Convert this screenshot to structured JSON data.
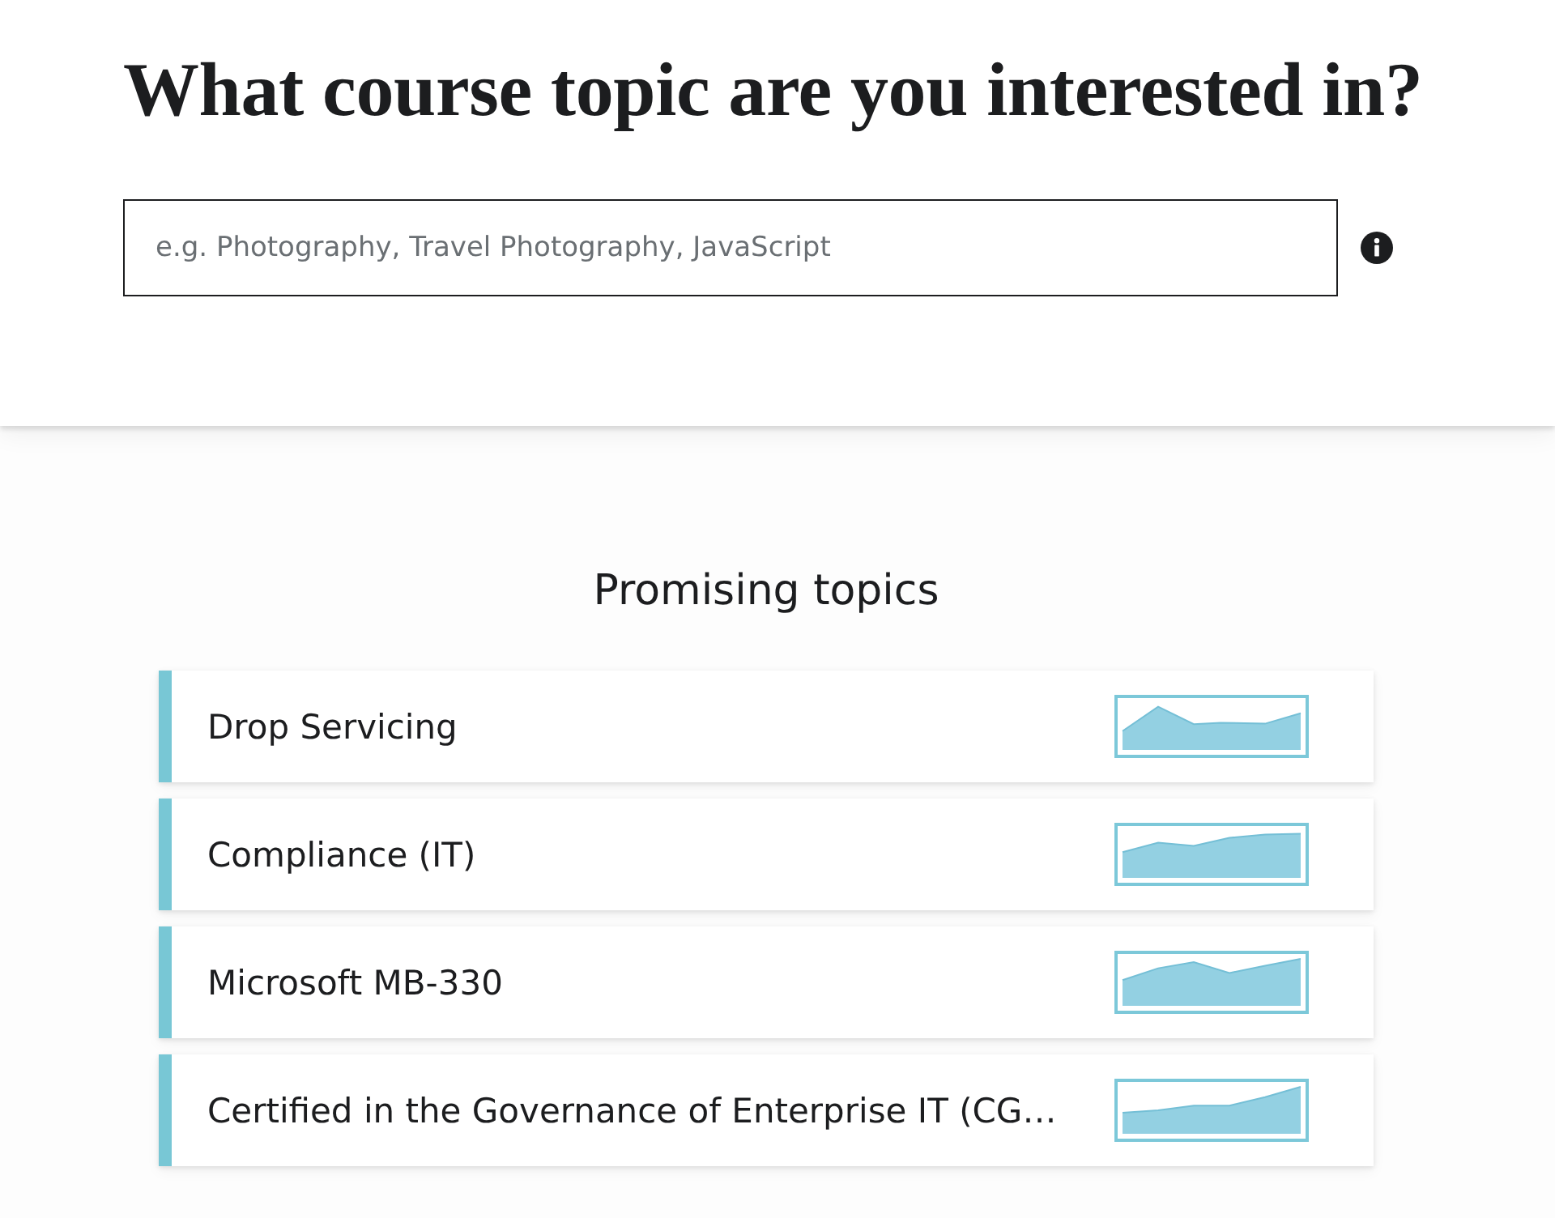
{
  "heading": "What course topic are you interested in?",
  "search": {
    "placeholder": "e.g. Photography, Travel Photography, JavaScript"
  },
  "topics_section": {
    "title": "Promising topics",
    "topics": [
      {
        "name": "Drop Servicing"
      },
      {
        "name": "Compliance (IT)"
      },
      {
        "name": "Microsoft MB-330"
      },
      {
        "name": "Certified in the Governance of Enterprise IT (CG…"
      }
    ]
  }
}
